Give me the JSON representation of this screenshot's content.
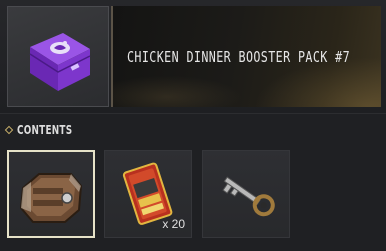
{
  "pack": {
    "title": "CHICKEN DINNER BOOSTER PACK #7",
    "thumbnail_icon": "purple-crate-icon"
  },
  "contents": {
    "label": "CONTENTS",
    "items": [
      {
        "icon": "armored-case-icon",
        "selected": true
      },
      {
        "icon": "coupon-card-icon",
        "quantity": "x 20"
      },
      {
        "icon": "key-icon"
      }
    ]
  },
  "colors": {
    "accent_gold": "#c9b06a",
    "crate_purple": "#7b35c8",
    "selected_border": "#e6e2c8"
  }
}
